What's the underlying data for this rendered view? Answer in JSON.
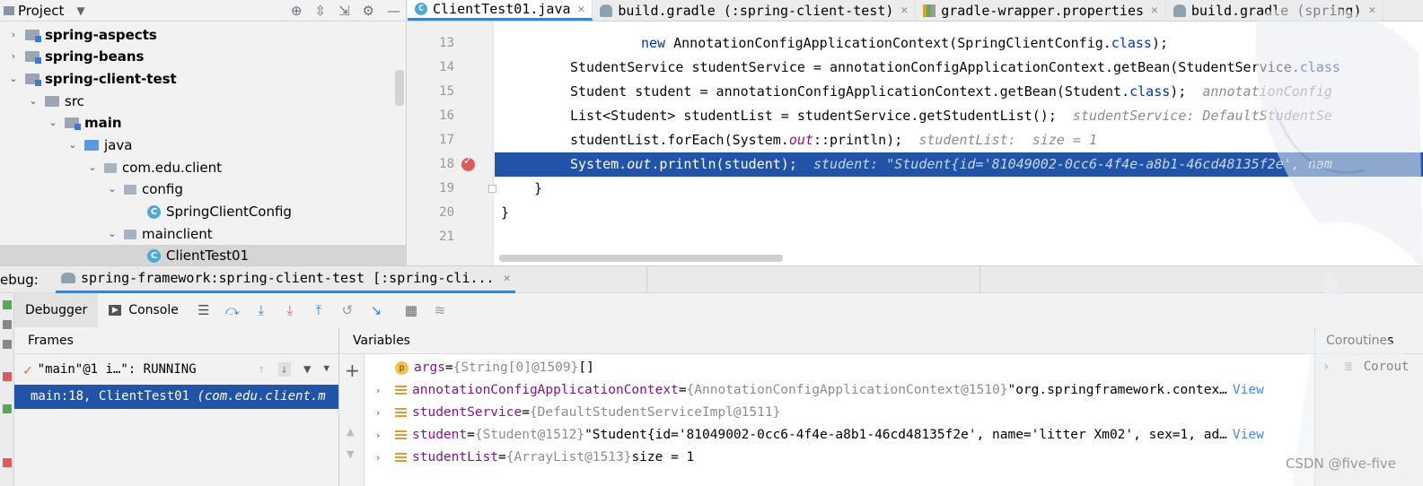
{
  "project": {
    "title": "Project",
    "tree": [
      {
        "label": "spring-aspects",
        "level": 0,
        "expand": "›"
      },
      {
        "label": "spring-beans",
        "level": 0,
        "expand": "›"
      },
      {
        "label": "spring-client-test",
        "level": 0,
        "expand": "⌄"
      },
      {
        "label": "src",
        "level": 1,
        "expand": "⌄"
      },
      {
        "label": "main",
        "level": 2,
        "expand": "⌄"
      },
      {
        "label": "java",
        "level": 3,
        "expand": "⌄"
      },
      {
        "label": "com.edu.client",
        "level": 4,
        "expand": "⌄"
      },
      {
        "label": "config",
        "level": 5,
        "expand": "⌄"
      },
      {
        "label": "SpringClientConfig",
        "level": 6,
        "expand": ""
      },
      {
        "label": "mainclient",
        "level": 5,
        "expand": "⌄"
      },
      {
        "label": "ClientTest01",
        "level": 6,
        "expand": ""
      }
    ]
  },
  "editor": {
    "tabs": [
      {
        "label": "ClientTest01.java"
      },
      {
        "label": "build.gradle (:spring-client-test)"
      },
      {
        "label": "gradle-wrapper.properties"
      },
      {
        "label": "build.gradle (spring)"
      }
    ],
    "line_numbers": [
      "13",
      "14",
      "15",
      "16",
      "17",
      "18",
      "19",
      "20",
      "21"
    ],
    "lines": {
      "l13a": "new ",
      "l13b": "AnnotationConfigApplicationContext(SpringClientConfig.",
      "l13c": "class",
      "l13d": ");",
      "l14a": "StudentService studentService = annotationConfigApplicationContext.getBean(StudentService.",
      "l14b": "class",
      "l15a": "Student student = annotationConfigApplicationContext.getBean(Student.",
      "l15b": "class",
      "l15c": ");  ",
      "l15hint": "annotationConfig",
      "l16a": "List<Student> studentList = studentService.getStudentList();  ",
      "l16hint": "studentService: DefaultStudentSe",
      "l17a": "studentList.forEach(System.",
      "l17b": "out",
      "l17c": "::println);  ",
      "l17hint": "studentList:  size = 1",
      "l18a": "System.",
      "l18b": "out",
      "l18c": ".println(student);  ",
      "l18hint": "student: \"Student{id='81049002-0cc6-4f4e-a8b1-46cd48135f2e', nam",
      "l19": "}",
      "l20": "}"
    }
  },
  "debug": {
    "label": "ebug:",
    "session_tab": "spring-framework:spring-client-test [:spring-cli...",
    "tabs": [
      {
        "label": "Debugger"
      },
      {
        "label": "Console"
      }
    ]
  },
  "frames": {
    "title": "Frames",
    "thread": "\"main\"@1 i…\": RUNNING",
    "selected_frame_a": "main:18, ClientTest01 ",
    "selected_frame_b": "(com.edu.client.m"
  },
  "variables": {
    "title": "Variables",
    "rows": [
      {
        "name": "args",
        "eq": " = ",
        "type": "{String[0]@1509}",
        "value": " []",
        "view": ""
      },
      {
        "name": "annotationConfigApplicationContext",
        "eq": " = ",
        "type": "{AnnotationConfigApplicationContext@1510}",
        "value": " \"org.springframework.contex…",
        "view": "View"
      },
      {
        "name": "studentService",
        "eq": " = ",
        "type": "{DefaultStudentServiceImpl@1511}",
        "value": "",
        "view": ""
      },
      {
        "name": "student",
        "eq": " = ",
        "type": "{Student@1512}",
        "value": " \"Student{id='81049002-0cc6-4f4e-a8b1-46cd48135f2e', name='litter Xm02', sex=1, ad…",
        "view": "View"
      },
      {
        "name": "studentList",
        "eq": " = ",
        "type": "{ArrayList@1513}",
        "value": "  size = 1",
        "view": ""
      }
    ]
  },
  "coroutines": {
    "title": "Coroutines",
    "row": "Corout"
  },
  "watermark": "CSDN @five-five"
}
